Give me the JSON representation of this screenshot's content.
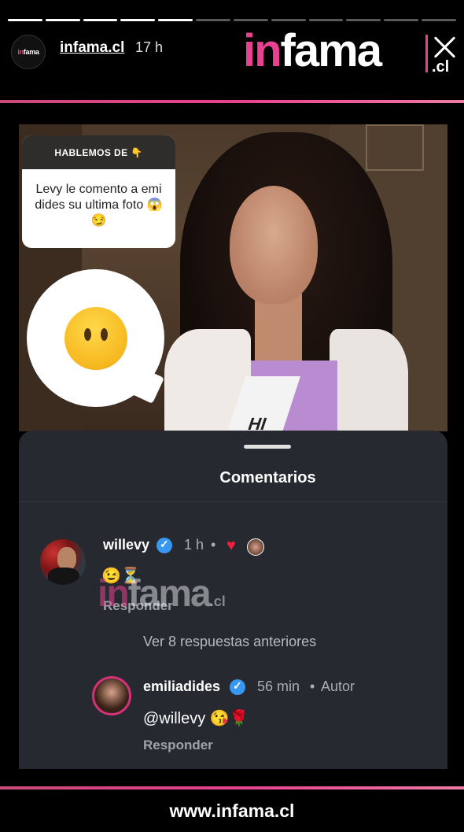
{
  "story": {
    "segments_total": 12,
    "segments_done": 5
  },
  "header": {
    "avatar_text_pink": "in",
    "avatar_text_white": "fama",
    "username": "infama.cl",
    "time": "17 h",
    "logo_pink": "in",
    "logo_white": "fama",
    "logo_suffix": ".cl"
  },
  "sticker": {
    "header": "HABLEMOS DE 👇",
    "text": "Levy le comento a emi dides su ultima foto 😱😏"
  },
  "photo": {
    "sash_text": "HI"
  },
  "comments_sheet": {
    "title": "Comentarios",
    "comments": [
      {
        "username": "willevy",
        "time": "1 h",
        "separator": "•",
        "text": "😉⏳",
        "reply_label": "Responder",
        "liked": true
      },
      {
        "username": "emiliadides",
        "time": "56 min",
        "separator": "•",
        "author_label": "Autor",
        "text": "@willevy 😘🌹",
        "reply_label": "Responder"
      }
    ],
    "view_previous": "Ver 8 respuestas anteriores",
    "watermark_pink": "in",
    "watermark_white": "fama",
    "watermark_suffix": ".cl"
  },
  "footer": {
    "url": "www.infama.cl"
  },
  "colors": {
    "brand_pink": "#e8418f",
    "verified_blue": "#3897f0",
    "heart_red": "#ef1f3c",
    "sheet_bg": "#26292f"
  }
}
